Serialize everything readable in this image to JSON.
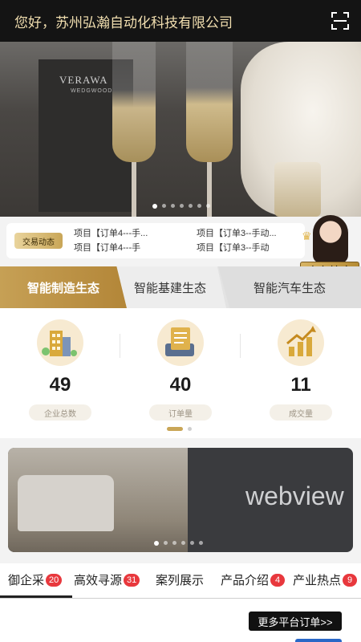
{
  "header": {
    "greeting": "您好，苏州弘瀚自动化科技有限公司",
    "scan_icon": "scan-icon"
  },
  "banner": {
    "box_brand": "VERAWA",
    "box_sub": "WEDGWOOD",
    "dot_count": 7,
    "active_dot": 0
  },
  "ticker": {
    "tag": "交易动态",
    "lines": [
      "项目【订单4---手...",
      "项目【订单3--手动...",
      "项目【订单4---手",
      "项目【订单3--手动"
    ]
  },
  "manager": {
    "label": "商务管家"
  },
  "eco_tabs": [
    {
      "label": "智能制造生态",
      "active": true
    },
    {
      "label": "智能基建生态",
      "active": false
    },
    {
      "label": "智能汽车生态",
      "active": false
    }
  ],
  "stats": [
    {
      "value": "49",
      "label": "企业总数",
      "icon": "building-icon"
    },
    {
      "value": "40",
      "label": "订单量",
      "icon": "order-document-icon"
    },
    {
      "value": "11",
      "label": "成交量",
      "icon": "growth-chart-icon"
    }
  ],
  "video": {
    "placeholder": "webview"
  },
  "bottom_tabs": [
    {
      "label": "御企采",
      "badge": "20"
    },
    {
      "label": "高效寻源",
      "badge": "31"
    },
    {
      "label": "案列展示",
      "badge": ""
    },
    {
      "label": "产品介绍",
      "badge": "4"
    },
    {
      "label": "产业热点",
      "badge": "9"
    }
  ],
  "more_button": "更多平台订单>>",
  "colors": {
    "gold": "#c9a657",
    "header_bg": "#141414",
    "badge_red": "#e8383d"
  }
}
